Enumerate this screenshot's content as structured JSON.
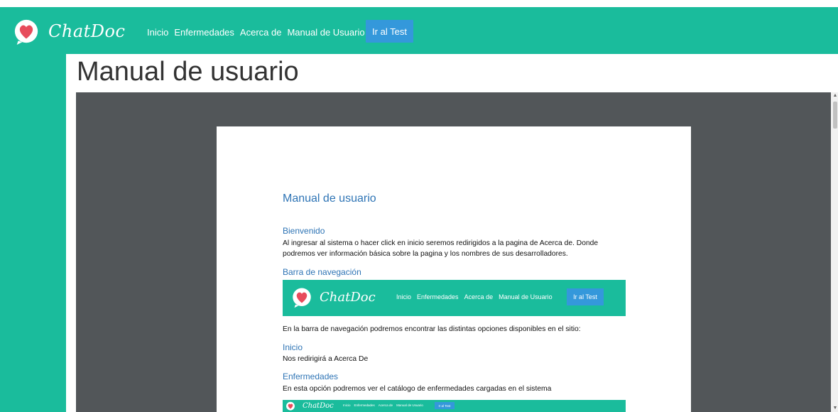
{
  "app": {
    "logo_text": "ChatDoc",
    "brand_color": "#1abc9c",
    "button_color": "#3498db"
  },
  "nav": {
    "links": [
      "Inicio",
      "Enfermedades",
      "Acerca de",
      "Manual de Usuario"
    ],
    "cta": "Ir al Test"
  },
  "page": {
    "title": "Manual de usuario"
  },
  "document": {
    "title": "Manual de usuario",
    "sections": [
      {
        "heading": "Bienvenido",
        "text": "Al ingresar al sistema o hacer click en inicio seremos redirigidos a la pagina de Acerca de. Donde podremos ver información básica sobre la pagina y los nombres de sus desarrolladores."
      },
      {
        "heading": "Barra de navegación",
        "text": "En la barra de navegación  podremos encontrar las distintas opciones disponibles en el sitio:"
      },
      {
        "heading": "Inicio",
        "text": "Nos redirigirá a Acerca De"
      },
      {
        "heading": "Enfermedades",
        "text": "En esta opción podremos ver el catálogo de enfermedades cargadas en el sistema"
      }
    ],
    "nav_image": {
      "logo_text": "ChatDoc",
      "links": [
        "Inicio",
        "Enfermedades",
        "Acerca de",
        "Manual de Usuario"
      ],
      "cta": "Ir al Test"
    }
  }
}
